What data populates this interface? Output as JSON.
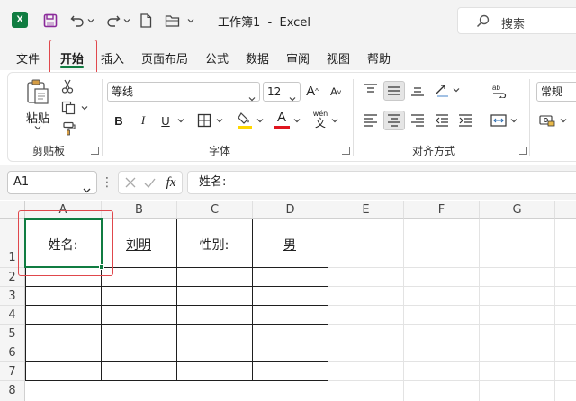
{
  "window": {
    "title": "工作簿1  -  Excel",
    "logo_letter": "X",
    "search_label": "搜索"
  },
  "tabs": [
    "文件",
    "开始",
    "插入",
    "页面布局",
    "公式",
    "数据",
    "审阅",
    "视图",
    "帮助"
  ],
  "active_tab": "开始",
  "ribbon": {
    "clipboard": {
      "paste_label": "粘贴",
      "group_label": "剪贴板"
    },
    "font": {
      "font_name": "等线",
      "font_size": "12",
      "bold": "B",
      "italic": "I",
      "underline": "U",
      "grow": "A",
      "shrink": "A",
      "font_color_letter": "A",
      "phonetic_top": "wén",
      "phonetic_bottom": "文",
      "group_label": "字体"
    },
    "alignment": {
      "group_label": "对齐方式"
    },
    "number": {
      "format": "常规"
    }
  },
  "formula_bar": {
    "name_box": "A1",
    "fx": "fx",
    "content": "姓名:"
  },
  "grid": {
    "columns": [
      "A",
      "B",
      "C",
      "D",
      "E",
      "F",
      "G"
    ],
    "rows": [
      "1",
      "2",
      "3",
      "4",
      "5",
      "6",
      "7",
      "8"
    ],
    "cells": {
      "A1": "姓名:",
      "B1": "刘明",
      "C1": "性别:",
      "D1": "男"
    },
    "active_cell": "A1"
  },
  "colors": {
    "accent": "#107c41",
    "highlight_box": "#e0474c",
    "highlight_color": "#ffd700",
    "font_color": "#e0151f"
  }
}
